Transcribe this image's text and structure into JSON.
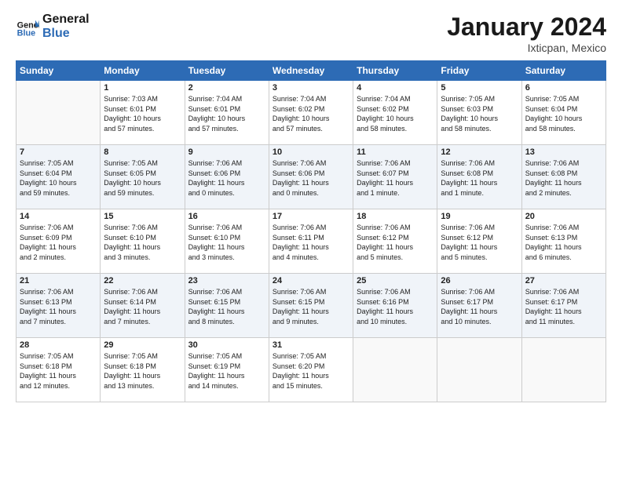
{
  "header": {
    "logo_line1": "General",
    "logo_line2": "Blue",
    "month": "January 2024",
    "location": "Ixticpan, Mexico"
  },
  "days_of_week": [
    "Sunday",
    "Monday",
    "Tuesday",
    "Wednesday",
    "Thursday",
    "Friday",
    "Saturday"
  ],
  "weeks": [
    [
      {
        "day": "",
        "info": ""
      },
      {
        "day": "1",
        "info": "Sunrise: 7:03 AM\nSunset: 6:01 PM\nDaylight: 10 hours\nand 57 minutes."
      },
      {
        "day": "2",
        "info": "Sunrise: 7:04 AM\nSunset: 6:01 PM\nDaylight: 10 hours\nand 57 minutes."
      },
      {
        "day": "3",
        "info": "Sunrise: 7:04 AM\nSunset: 6:02 PM\nDaylight: 10 hours\nand 57 minutes."
      },
      {
        "day": "4",
        "info": "Sunrise: 7:04 AM\nSunset: 6:02 PM\nDaylight: 10 hours\nand 58 minutes."
      },
      {
        "day": "5",
        "info": "Sunrise: 7:05 AM\nSunset: 6:03 PM\nDaylight: 10 hours\nand 58 minutes."
      },
      {
        "day": "6",
        "info": "Sunrise: 7:05 AM\nSunset: 6:04 PM\nDaylight: 10 hours\nand 58 minutes."
      }
    ],
    [
      {
        "day": "7",
        "info": "Sunrise: 7:05 AM\nSunset: 6:04 PM\nDaylight: 10 hours\nand 59 minutes."
      },
      {
        "day": "8",
        "info": "Sunrise: 7:05 AM\nSunset: 6:05 PM\nDaylight: 10 hours\nand 59 minutes."
      },
      {
        "day": "9",
        "info": "Sunrise: 7:06 AM\nSunset: 6:06 PM\nDaylight: 11 hours\nand 0 minutes."
      },
      {
        "day": "10",
        "info": "Sunrise: 7:06 AM\nSunset: 6:06 PM\nDaylight: 11 hours\nand 0 minutes."
      },
      {
        "day": "11",
        "info": "Sunrise: 7:06 AM\nSunset: 6:07 PM\nDaylight: 11 hours\nand 1 minute."
      },
      {
        "day": "12",
        "info": "Sunrise: 7:06 AM\nSunset: 6:08 PM\nDaylight: 11 hours\nand 1 minute."
      },
      {
        "day": "13",
        "info": "Sunrise: 7:06 AM\nSunset: 6:08 PM\nDaylight: 11 hours\nand 2 minutes."
      }
    ],
    [
      {
        "day": "14",
        "info": "Sunrise: 7:06 AM\nSunset: 6:09 PM\nDaylight: 11 hours\nand 2 minutes."
      },
      {
        "day": "15",
        "info": "Sunrise: 7:06 AM\nSunset: 6:10 PM\nDaylight: 11 hours\nand 3 minutes."
      },
      {
        "day": "16",
        "info": "Sunrise: 7:06 AM\nSunset: 6:10 PM\nDaylight: 11 hours\nand 3 minutes."
      },
      {
        "day": "17",
        "info": "Sunrise: 7:06 AM\nSunset: 6:11 PM\nDaylight: 11 hours\nand 4 minutes."
      },
      {
        "day": "18",
        "info": "Sunrise: 7:06 AM\nSunset: 6:12 PM\nDaylight: 11 hours\nand 5 minutes."
      },
      {
        "day": "19",
        "info": "Sunrise: 7:06 AM\nSunset: 6:12 PM\nDaylight: 11 hours\nand 5 minutes."
      },
      {
        "day": "20",
        "info": "Sunrise: 7:06 AM\nSunset: 6:13 PM\nDaylight: 11 hours\nand 6 minutes."
      }
    ],
    [
      {
        "day": "21",
        "info": "Sunrise: 7:06 AM\nSunset: 6:13 PM\nDaylight: 11 hours\nand 7 minutes."
      },
      {
        "day": "22",
        "info": "Sunrise: 7:06 AM\nSunset: 6:14 PM\nDaylight: 11 hours\nand 7 minutes."
      },
      {
        "day": "23",
        "info": "Sunrise: 7:06 AM\nSunset: 6:15 PM\nDaylight: 11 hours\nand 8 minutes."
      },
      {
        "day": "24",
        "info": "Sunrise: 7:06 AM\nSunset: 6:15 PM\nDaylight: 11 hours\nand 9 minutes."
      },
      {
        "day": "25",
        "info": "Sunrise: 7:06 AM\nSunset: 6:16 PM\nDaylight: 11 hours\nand 10 minutes."
      },
      {
        "day": "26",
        "info": "Sunrise: 7:06 AM\nSunset: 6:17 PM\nDaylight: 11 hours\nand 10 minutes."
      },
      {
        "day": "27",
        "info": "Sunrise: 7:06 AM\nSunset: 6:17 PM\nDaylight: 11 hours\nand 11 minutes."
      }
    ],
    [
      {
        "day": "28",
        "info": "Sunrise: 7:05 AM\nSunset: 6:18 PM\nDaylight: 11 hours\nand 12 minutes."
      },
      {
        "day": "29",
        "info": "Sunrise: 7:05 AM\nSunset: 6:18 PM\nDaylight: 11 hours\nand 13 minutes."
      },
      {
        "day": "30",
        "info": "Sunrise: 7:05 AM\nSunset: 6:19 PM\nDaylight: 11 hours\nand 14 minutes."
      },
      {
        "day": "31",
        "info": "Sunrise: 7:05 AM\nSunset: 6:20 PM\nDaylight: 11 hours\nand 15 minutes."
      },
      {
        "day": "",
        "info": ""
      },
      {
        "day": "",
        "info": ""
      },
      {
        "day": "",
        "info": ""
      }
    ]
  ]
}
